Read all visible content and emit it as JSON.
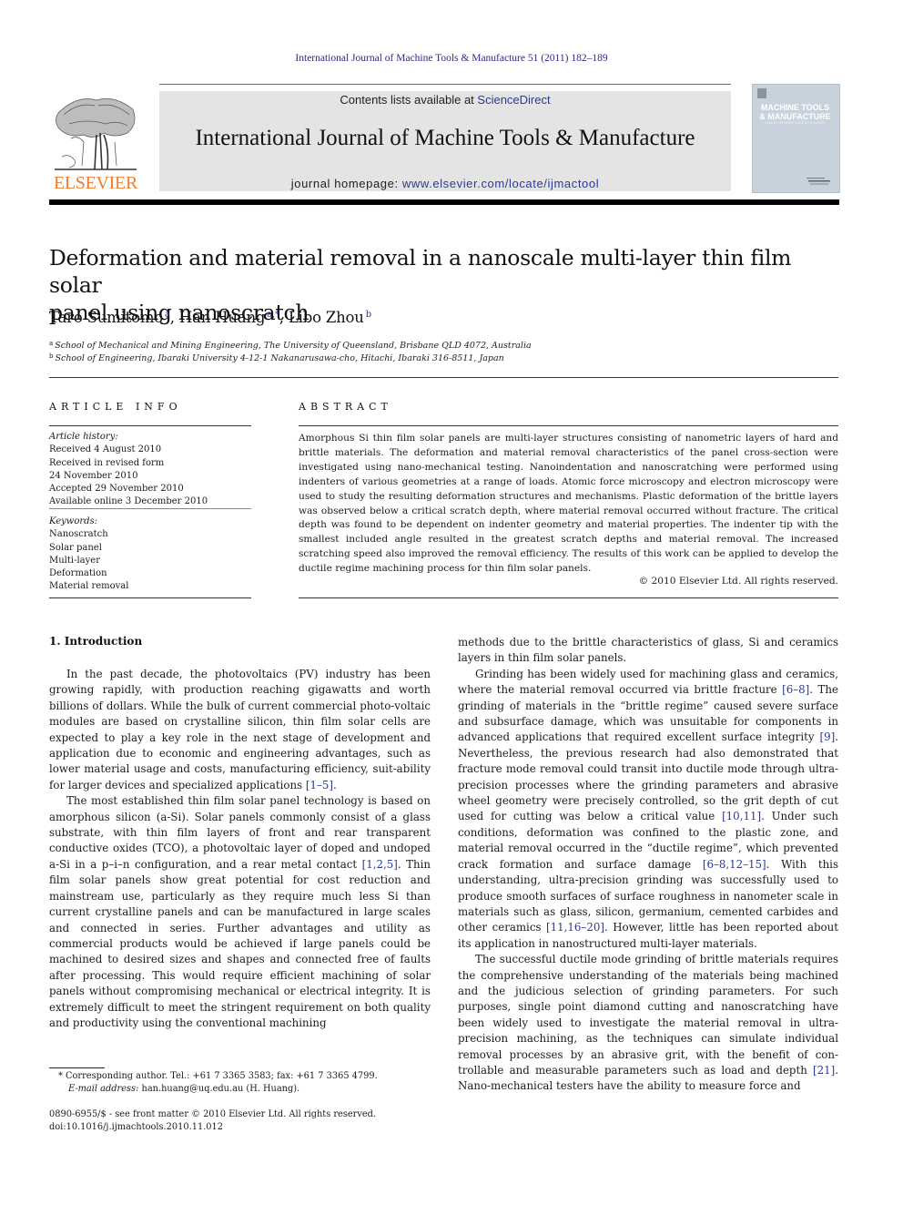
{
  "running_head": "International Journal of Machine Tools & Manufacture 51 (2011) 182–189",
  "banner": {
    "publisher_logo_text": "ELSEVIER",
    "contents_prefix": "Contents lists available at ",
    "contents_link": "ScienceDirect",
    "journal_title": "International Journal of Machine Tools & Manufacture",
    "homepage_prefix": "journal homepage: ",
    "homepage_link": "www.elsevier.com/locate/ijmactool",
    "cover_title_line1": "MACHINE TOOLS",
    "cover_title_line2": "& MANUFACTURE",
    "cover_subtitle": "DESIGN, RESEARCH AND APPLICATION"
  },
  "colors": {
    "elsevier_orange": "#f07c2c",
    "link_blue": "#2a3a99",
    "banner_gray": "#e4e4e4"
  },
  "article": {
    "title_line1": "Deformation and material removal in a nanoscale multi-layer thin film solar",
    "title_line2": "panel using nanoscratch",
    "authors": [
      {
        "name": "Taro Sumitomo",
        "sup": "a"
      },
      {
        "name": "Han Huang",
        "sup": "a,*"
      },
      {
        "name": "Libo Zhou",
        "sup": "b"
      }
    ],
    "affiliations": [
      {
        "mark": "a",
        "text": "School of Mechanical and Mining Engineering, The University of Queensland, Brisbane QLD 4072, Australia"
      },
      {
        "mark": "b",
        "text": "School of Engineering, Ibaraki University 4-12-1 Nakanarusawa-cho, Hitachi, Ibaraki 316-8511, Japan"
      }
    ]
  },
  "article_info": {
    "heading": "ARTICLE INFO",
    "history_label": "Article history:",
    "history": [
      "Received 4 August 2010",
      "Received in revised form",
      "24 November 2010",
      "Accepted 29 November 2010",
      "Available online 3 December 2010"
    ],
    "keywords_label": "Keywords:",
    "keywords": [
      "Nanoscratch",
      "Solar panel",
      "Multi-layer",
      "Deformation",
      "Material removal"
    ]
  },
  "abstract": {
    "heading": "ABSTRACT",
    "text": "Amorphous Si thin film solar panels are multi-layer structures consisting of nanometric layers of hard and brittle materials. The deformation and material removal characteristics of the panel cross-section were investigated using nano-mechanical testing. Nanoindentation and nanoscratching were performed using indenters of various geometries at a range of loads. Atomic force microscopy and electron microscopy were used to study the resulting deformation structures and mechanisms. Plastic deformation of the brittle layers was observed below a critical scratch depth, where material removal occurred without fracture. The critical depth was found to be dependent on indenter geometry and material properties. The indenter tip with the smallest included angle resulted in the greatest scratch depths and material removal. The increased scratching speed also improved the removal efficiency. The results of this work can be applied to develop the ductile regime machining process for thin film solar panels.",
    "copyright": "© 2010 Elsevier Ltd. All rights reserved."
  },
  "introduction": {
    "heading": "1.  Introduction",
    "p1_a": "In the past decade, the photovoltaics (PV) industry has been growing rapidly, with production reaching gigawatts and worth billions of dollars. While the bulk of current commercial photo-voltaic modules are based on crystalline silicon, thin film solar cells are expected to play a key role in the next stage of development and application due to economic and engineering advantages, such as lower material usage and costs, manufacturing efficiency, suit-ability for larger devices and specialized applications ",
    "p1_cite": "[1–5]",
    "p1_b": ".",
    "p2_a": "The most established thin film solar panel technology is based on amorphous silicon (a-Si). Solar panels commonly consist of a glass substrate, with thin film layers of front and rear transparent conductive oxides (TCO), a photovoltaic layer of doped and undoped a-Si in a p–i–n configuration, and a rear metal contact ",
    "p2_cite": "[1,2,5]",
    "p2_b": ". Thin film solar panels show great potential for cost reduction and mainstream use, particularly as they require much less Si than current crystalline panels and can be manufactured in large scales and connected in series. Further advantages and utility as commercial products would be achieved if large panels could be machined to desired sizes and shapes and connected free of faults after processing. This would require efficient machining of solar panels without compromising mechanical or electrical integrity. It is extremely difficult to meet the stringent requirement on both quality and productivity using the conventional machining",
    "p2_cont": "methods due to the brittle characteristics of glass, Si and ceramics layers in thin film solar panels.",
    "p3_a": "Grinding has been widely used for machining glass and ceramics, where the material removal occurred via brittle fracture ",
    "p3_cite1": "[6–8]",
    "p3_b": ". The grinding of materials in the “brittle regime” caused severe surface and subsurface damage, which was unsuitable for components in advanced applications that required excellent surface integrity ",
    "p3_cite2": "[9]",
    "p3_c": ". Nevertheless, the previous research had also demonstrated that fracture mode removal could transit into ductile mode through ultra-precision processes where the grinding parameters and abrasive wheel geometry were precisely controlled, so the grit depth of cut used for cutting was below a critical value ",
    "p3_cite3": "[10,11]",
    "p3_d": ". Under such conditions, deformation was confined to the plastic zone, and material removal occurred in the “ductile regime”, which prevented crack formation and surface damage ",
    "p3_cite4": "[6–8,12–15]",
    "p3_e": ". With this understanding, ultra-precision grinding was successfully used to produce smooth surfaces of surface roughness in nanometer scale in materials such as glass, silicon, germanium, cemented carbides and other ceramics ",
    "p3_cite5": "[11,16–20]",
    "p3_f": ". However, little has been reported about its application in nanostructured multi-layer materials.",
    "p4_a": "The successful ductile mode grinding of brittle materials requires the comprehensive understanding of the materials being machined and the judicious selection of grinding parameters. For such purposes, single point diamond cutting and nanoscratching have been widely used to investigate the material removal in ultra-precision machining, as the techniques can simulate individual removal processes by an abrasive grit, with the benefit of con-trollable and measurable parameters such as load and depth ",
    "p4_cite": "[21]",
    "p4_b": ". Nano-mechanical testers have the ability to measure force and"
  },
  "footnotes": {
    "corresponding": "* Corresponding author. Tel.: +61 7 3365 3583; fax: +61 7 3365 4799.",
    "email_label": "E-mail address:",
    "email_value": " han.huang@uq.edu.au (H. Huang).",
    "issn": "0890-6955/$ - see front matter © 2010 Elsevier Ltd. All rights reserved.",
    "doi": "doi:10.1016/j.ijmachtools.2010.11.012"
  }
}
